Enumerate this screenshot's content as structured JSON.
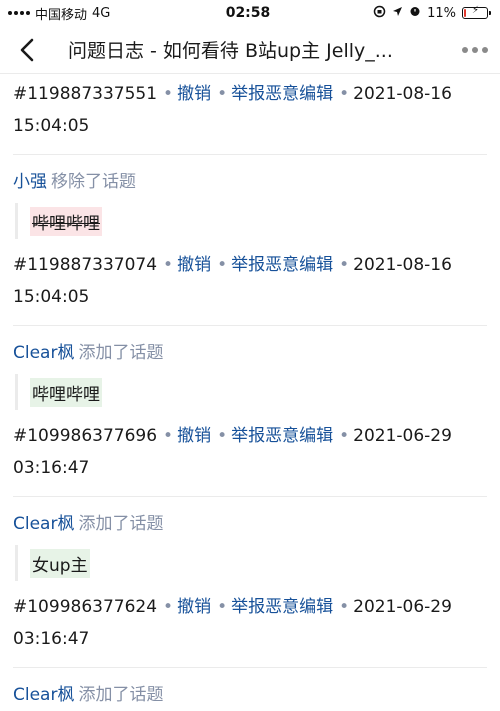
{
  "status_bar": {
    "carrier": "中国移动",
    "network": "4G",
    "time": "02:58",
    "battery_pct": "11%",
    "battery_level": 0.11
  },
  "nav": {
    "title": "问题日志 - 如何看待 B站up主 Jelly_..."
  },
  "actions": {
    "revoke": "撤销",
    "report": "举报恶意编辑"
  },
  "entries": [
    {
      "actor": "",
      "action": "",
      "topic": "",
      "id": "#119887337551",
      "date": "2021-08-16",
      "time": "15:04:05"
    },
    {
      "actor": "小强",
      "action": "移除了话题",
      "topic": "哔哩哔哩",
      "topic_state": "removed",
      "id": "#119887337074",
      "date": "2021-08-16",
      "time": "15:04:05"
    },
    {
      "actor": "Clear枫",
      "action": "添加了话题",
      "topic": "哔哩哔哩",
      "topic_state": "added",
      "id": "#109986377696",
      "date": "2021-06-29",
      "time": "03:16:47"
    },
    {
      "actor": "Clear枫",
      "action": "添加了话题",
      "topic": "女up主",
      "topic_state": "added",
      "id": "#109986377624",
      "date": "2021-06-29",
      "time": "03:16:47"
    },
    {
      "actor": "Clear枫",
      "action": "添加了话题"
    }
  ],
  "colors": {
    "link": "#175199",
    "muted": "#8590a6",
    "added_bg": "#e7f3e7",
    "removed_bg": "#fbe4e6"
  }
}
